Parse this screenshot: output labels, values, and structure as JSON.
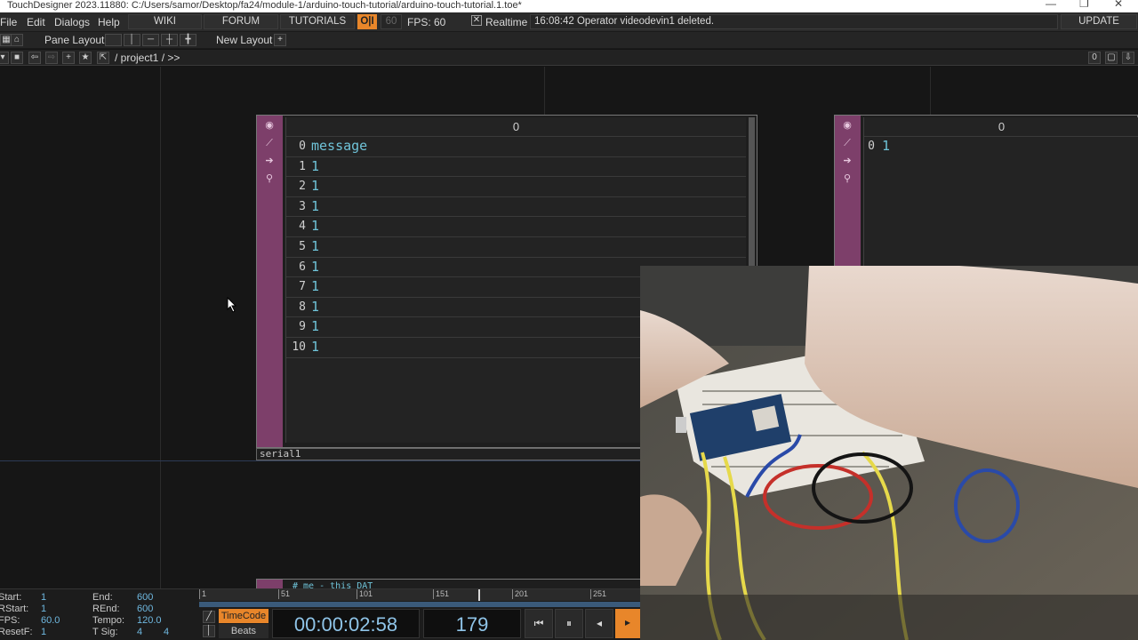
{
  "titlebar": {
    "text": "TouchDesigner 2023.11880: C:/Users/samor/Desktop/fa24/module-1/arduino-touch-tutorial/arduino-touch-tutorial.1.toe*"
  },
  "menu": {
    "file": "File",
    "edit": "Edit",
    "dialogs": "Dialogs",
    "help": "Help",
    "wiki": "WIKI",
    "forum": "FORUM",
    "tutorials": "TUTORIALS",
    "oi": "O|I",
    "fps_target": "60",
    "fps_label": "FPS:",
    "fps_value": "60",
    "realtime": "Realtime",
    "status": "16:08:42 Operator videodevin1 deleted.",
    "update": "UPDATE"
  },
  "panebar": {
    "pane_layout": "Pane Layout",
    "new_layout": "New Layout"
  },
  "pathbar": {
    "path": "/ project1 / >>",
    "counter": "0"
  },
  "serial_dat": {
    "name": "serial1",
    "col_header": "0",
    "rows": [
      {
        "n": "0",
        "v": "message"
      },
      {
        "n": "1",
        "v": "1"
      },
      {
        "n": "2",
        "v": "1"
      },
      {
        "n": "3",
        "v": "1"
      },
      {
        "n": "4",
        "v": "1"
      },
      {
        "n": "5",
        "v": "1"
      },
      {
        "n": "6",
        "v": "1"
      },
      {
        "n": "7",
        "v": "1"
      },
      {
        "n": "8",
        "v": "1"
      },
      {
        "n": "9",
        "v": "1"
      },
      {
        "n": "10",
        "v": "1"
      }
    ]
  },
  "right_dat": {
    "col_header": "0",
    "row_n": "0",
    "row_v": "1"
  },
  "code_dat": {
    "snippet": "# me - this DAT"
  },
  "timeline": {
    "start_label": "Start:",
    "start": "1",
    "rstart_label": "RStart:",
    "rstart": "1",
    "fps_label": "FPS:",
    "fps": "60.0",
    "resetf_label": "ResetF:",
    "resetf": "1",
    "end_label": "End:",
    "end": "600",
    "rend_label": "REnd:",
    "rend": "600",
    "tempo_label": "Tempo:",
    "tempo": "120.0",
    "tsig_label": "T Sig:",
    "tsig_a": "4",
    "tsig_b": "4",
    "ticks": [
      "1",
      "51",
      "101",
      "151",
      "201",
      "251"
    ],
    "timecode_tab": "TimeCode",
    "beats_tab": "Beats",
    "timecode": "00:00:02:58",
    "frame": "179"
  },
  "colors": {
    "op_side": "#7d3f6a",
    "dat_text": "#6fc3d8",
    "accent_orange": "#e8862a"
  }
}
